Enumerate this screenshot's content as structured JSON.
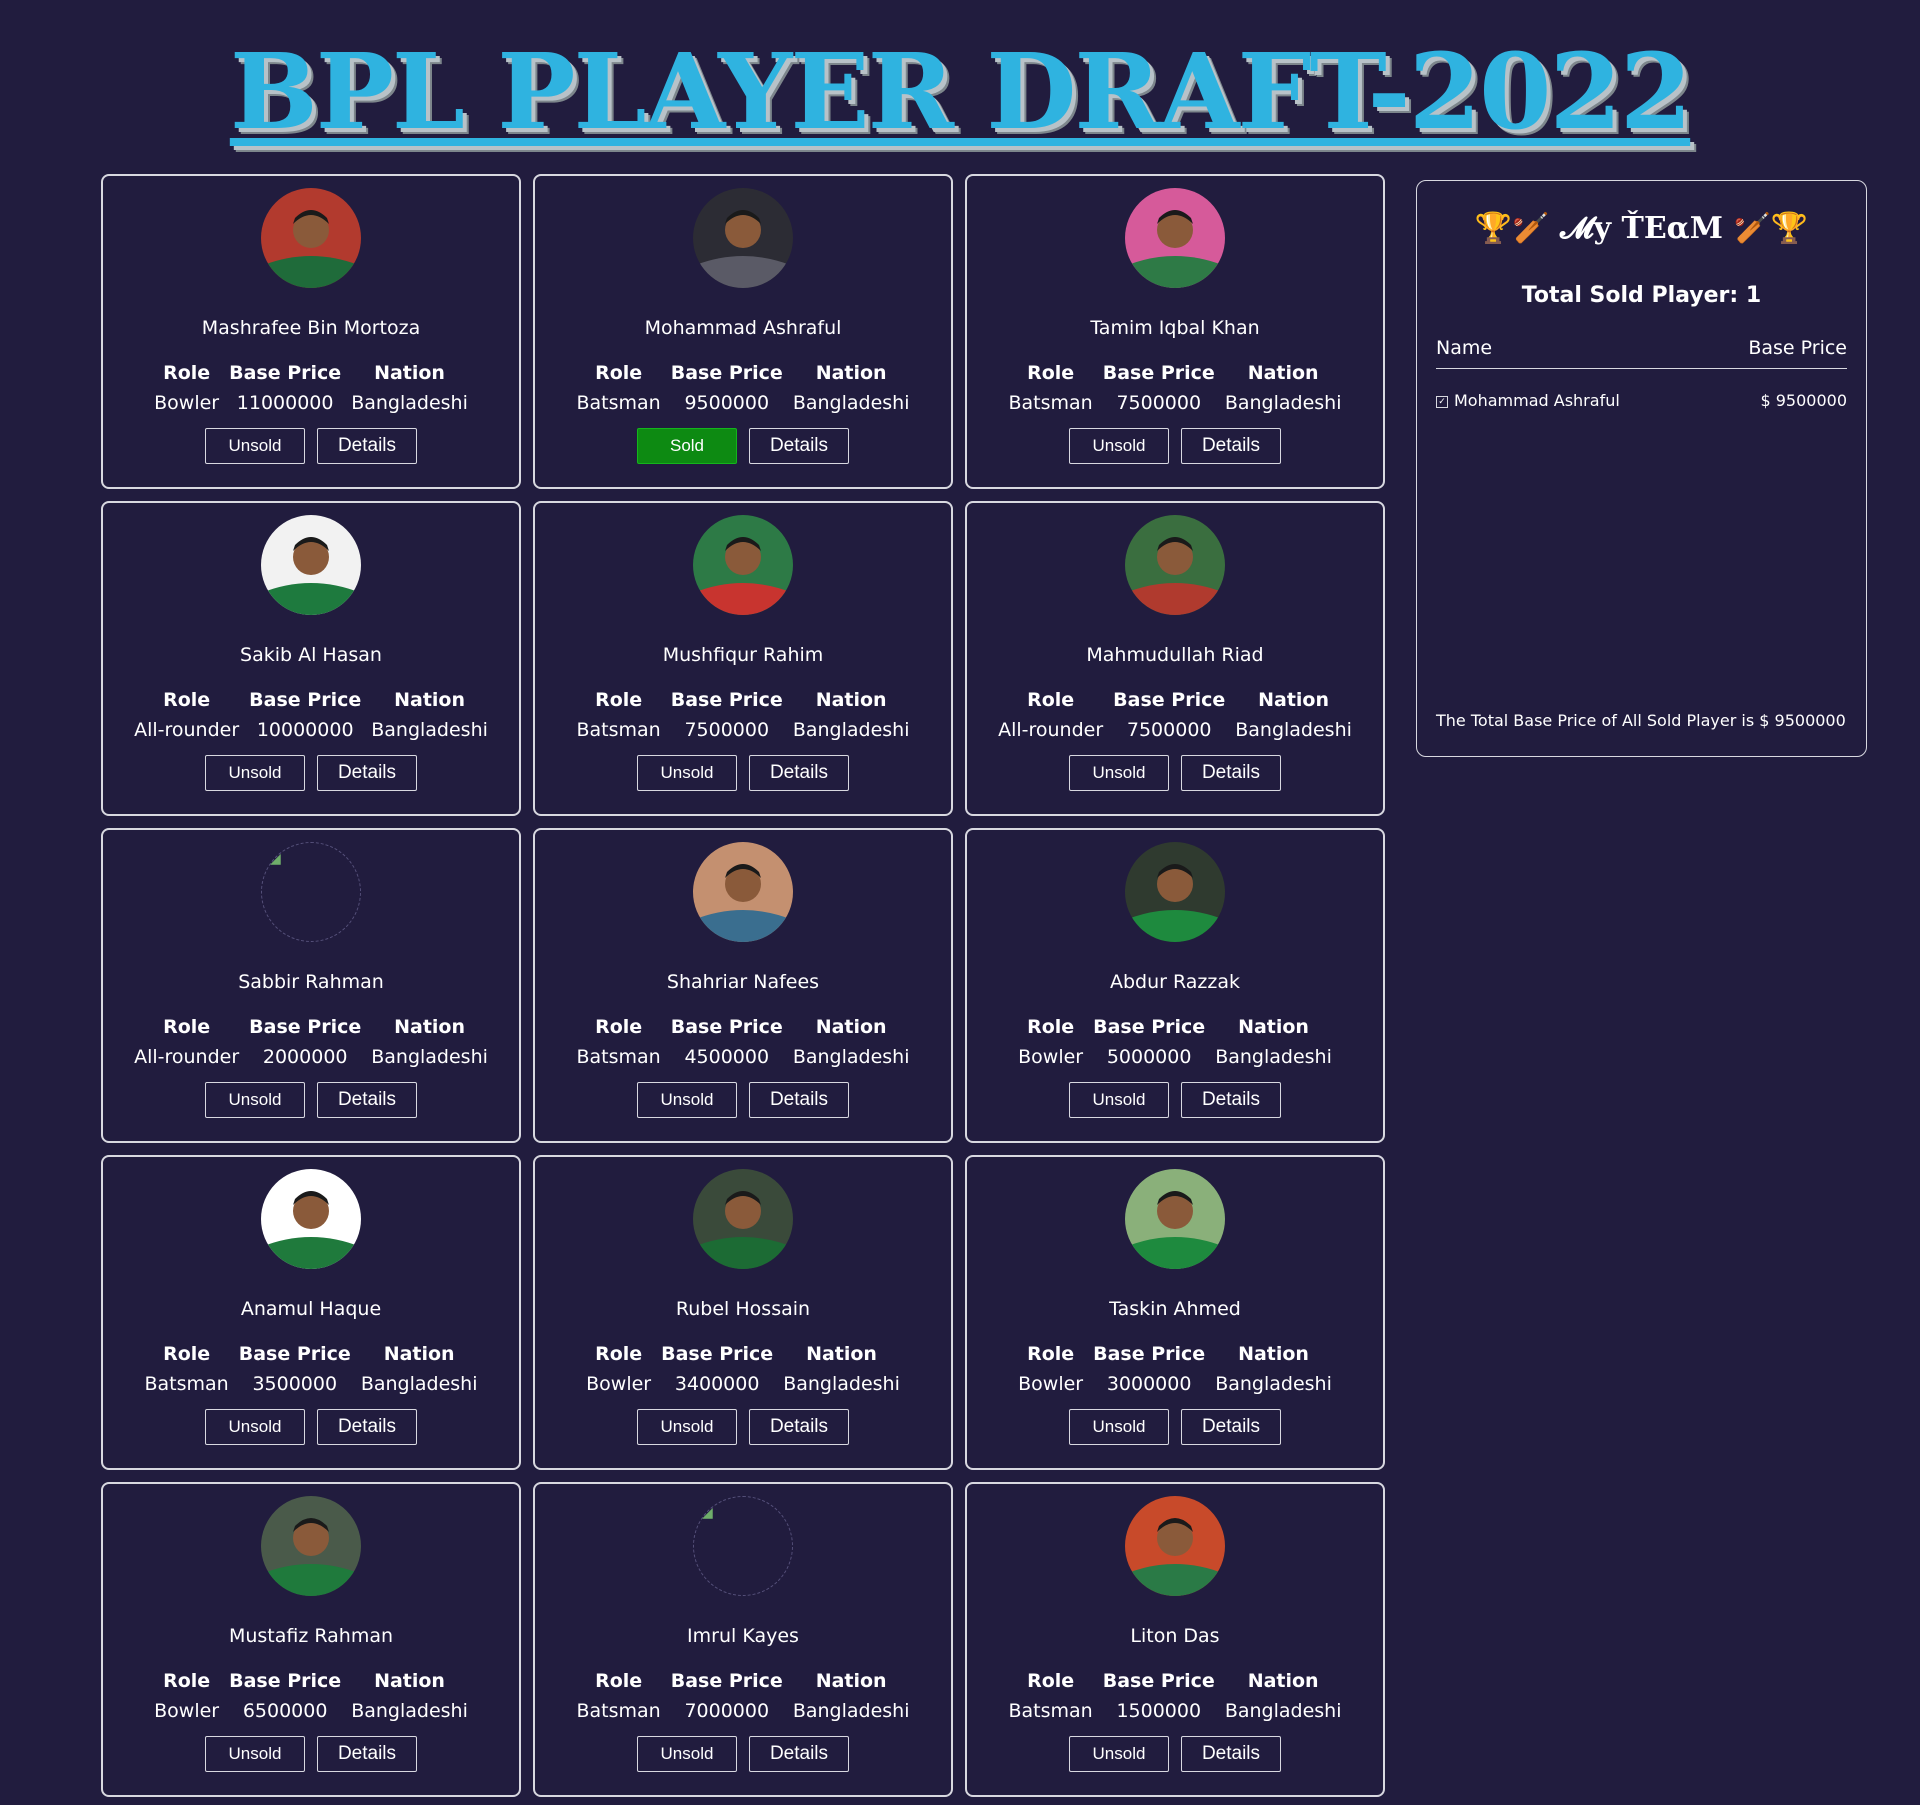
{
  "page_title": "BPL PLAYER DRAFT-2022",
  "card_labels": {
    "role": "Role",
    "base_price": "Base Price",
    "nation": "Nation",
    "details": "Details"
  },
  "players": [
    {
      "name": "Mashrafee Bin Mortoza",
      "role": "Bowler",
      "base_price": "11000000",
      "nation": "Bangladeshi",
      "status": "Unsold",
      "photo": "photo"
    },
    {
      "name": "Mohammad Ashraful",
      "role": "Batsman",
      "base_price": "9500000",
      "nation": "Bangladeshi",
      "status": "Sold",
      "photo": "photo"
    },
    {
      "name": "Tamim Iqbal Khan",
      "role": "Batsman",
      "base_price": "7500000",
      "nation": "Bangladeshi",
      "status": "Unsold",
      "photo": "photo"
    },
    {
      "name": "Sakib Al Hasan",
      "role": "All-rounder",
      "base_price": "10000000",
      "nation": "Bangladeshi",
      "status": "Unsold",
      "photo": "photo"
    },
    {
      "name": "Mushfiqur Rahim",
      "role": "Batsman",
      "base_price": "7500000",
      "nation": "Bangladeshi",
      "status": "Unsold",
      "photo": "photo"
    },
    {
      "name": "Mahmudullah Riad",
      "role": "All-rounder",
      "base_price": "7500000",
      "nation": "Bangladeshi",
      "status": "Unsold",
      "photo": "photo"
    },
    {
      "name": "Sabbir Rahman",
      "role": "All-rounder",
      "base_price": "2000000",
      "nation": "Bangladeshi",
      "status": "Unsold",
      "photo": "broken"
    },
    {
      "name": "Shahriar Nafees",
      "role": "Batsman",
      "base_price": "4500000",
      "nation": "Bangladeshi",
      "status": "Unsold",
      "photo": "photo"
    },
    {
      "name": "Abdur Razzak",
      "role": "Bowler",
      "base_price": "5000000",
      "nation": "Bangladeshi",
      "status": "Unsold",
      "photo": "photo"
    },
    {
      "name": "Anamul Haque",
      "role": "Batsman",
      "base_price": "3500000",
      "nation": "Bangladeshi",
      "status": "Unsold",
      "photo": "photo"
    },
    {
      "name": "Rubel Hossain",
      "role": "Bowler",
      "base_price": "3400000",
      "nation": "Bangladeshi",
      "status": "Unsold",
      "photo": "photo"
    },
    {
      "name": "Taskin Ahmed",
      "role": "Bowler",
      "base_price": "3000000",
      "nation": "Bangladeshi",
      "status": "Unsold",
      "photo": "photo"
    },
    {
      "name": "Mustafiz Rahman",
      "role": "Bowler",
      "base_price": "6500000",
      "nation": "Bangladeshi",
      "status": "Unsold",
      "photo": "photo"
    },
    {
      "name": "Imrul Kayes",
      "role": "Batsman",
      "base_price": "7000000",
      "nation": "Bangladeshi",
      "status": "Unsold",
      "photo": "broken"
    },
    {
      "name": "Liton Das",
      "role": "Batsman",
      "base_price": "1500000",
      "nation": "Bangladeshi",
      "status": "Unsold",
      "photo": "photo"
    }
  ],
  "team": {
    "title": "𝓜y ŤEαM",
    "trophy_icon": "🏆",
    "bat_icon": "🏏",
    "count_label": "Total Sold Player: 1",
    "col_name": "Name",
    "col_price": "Base Price",
    "rows": [
      {
        "name": "Mohammad Ashraful",
        "price": "$ 9500000"
      }
    ],
    "total_text": "The Total Base Price of All Sold Player is $ 9500000"
  },
  "colors": {
    "background": "#211c3e",
    "title": "#2fb3e0",
    "sold": "#0d8a12"
  }
}
